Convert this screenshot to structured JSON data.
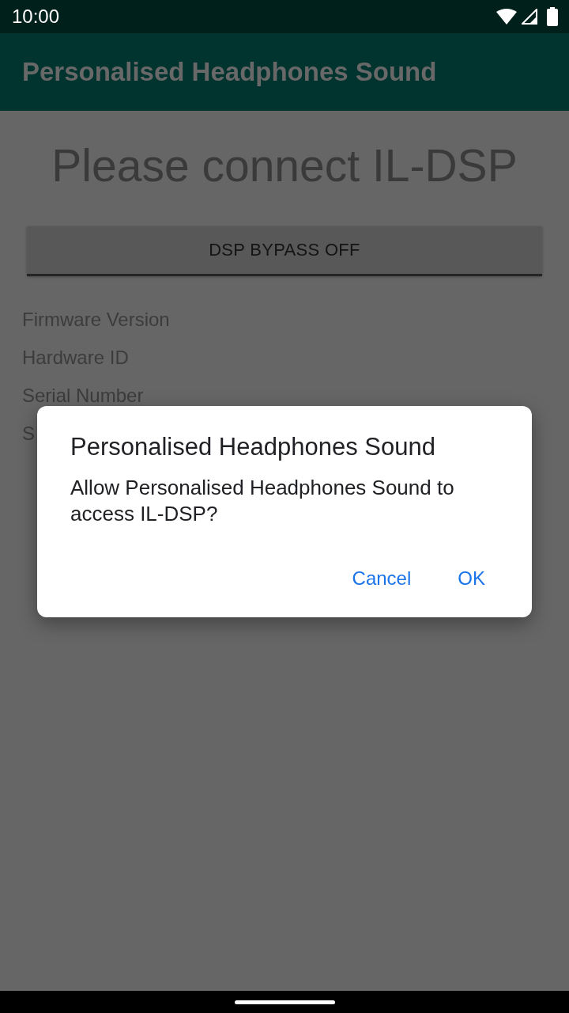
{
  "status_bar": {
    "time": "10:00"
  },
  "app_bar": {
    "title": "Personalised Headphones Sound"
  },
  "content": {
    "heading": "Please connect IL-DSP",
    "bypass_button": {
      "label": "DSP BYPASS OFF"
    },
    "info_labels": [
      "Firmware Version",
      "Hardware ID",
      "Serial Number",
      "S"
    ]
  },
  "dialog": {
    "title": "Personalised Headphones Sound",
    "message": "Allow Personalised Headphones Sound to access IL-DSP?",
    "buttons": [
      {
        "label": "Cancel"
      },
      {
        "label": "OK"
      }
    ]
  }
}
